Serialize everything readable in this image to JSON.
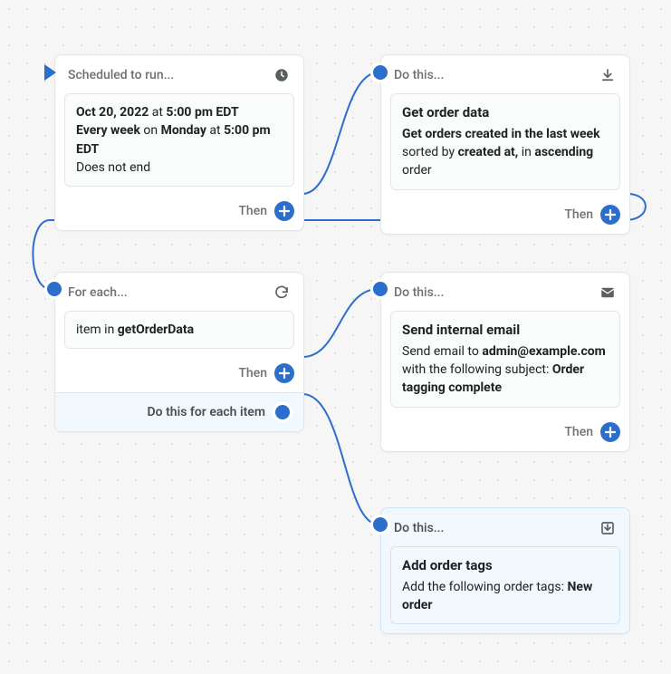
{
  "nodes": {
    "trigger": {
      "header": "Scheduled to run...",
      "icon": "clock-icon",
      "date_prefix": "Oct 20, 2022",
      "at1": " at ",
      "time1": "5:00 pm EDT",
      "freq_prefix": "Every week",
      "on": " on ",
      "day": "Monday",
      "at2": " at ",
      "time2": "5:00 pm EDT",
      "end": "Does not end",
      "then": "Then"
    },
    "getOrder": {
      "header": "Do this...",
      "icon": "download-icon",
      "title": "Get order data",
      "p1_bold1": "Get orders created in the last week",
      "p1_mid": " sorted by ",
      "p1_bold2": "created at,",
      "p1_mid2": " in ",
      "p1_bold3": "ascending",
      "p1_tail": " order",
      "then": "Then"
    },
    "forEach": {
      "header": "For each...",
      "icon": "refresh-icon",
      "item_prefix": "item in ",
      "item_var": "getOrderData",
      "then": "Then",
      "each_label": "Do this for each item"
    },
    "email": {
      "header": "Do this...",
      "icon": "email-icon",
      "title": "Send internal email",
      "p1": "Send email to ",
      "addr": "admin@example.com",
      "p2": " with the following subject: ",
      "subj": "Order tagging complete",
      "then": "Then"
    },
    "addTags": {
      "header": "Do this...",
      "icon": "import-icon",
      "title": "Add order tags",
      "p1": "Add the following order tags: ",
      "tag": "New order"
    }
  },
  "colors": {
    "accent": "#2c6ecb"
  }
}
